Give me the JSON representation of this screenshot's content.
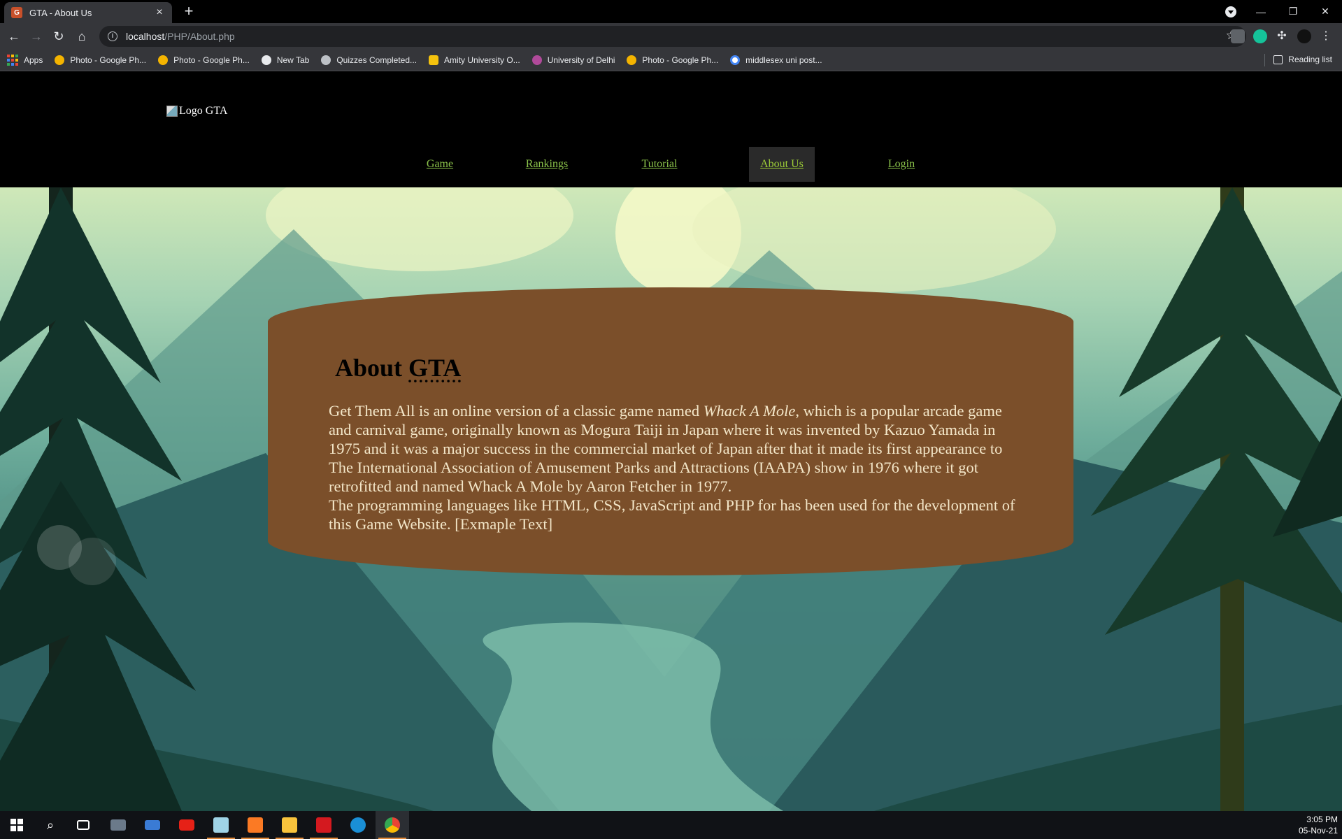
{
  "browser": {
    "tab_title": "GTA - About Us",
    "url_host": "localhost",
    "url_path": "/PHP/About.php",
    "bookmarks": [
      {
        "label": "Apps",
        "color": "#e8eaed"
      },
      {
        "label": "Photo - Google Ph...",
        "color": "#f4b400"
      },
      {
        "label": "Photo - Google Ph...",
        "color": "#f4b400"
      },
      {
        "label": "New Tab",
        "color": "#e8eaed"
      },
      {
        "label": "Quizzes Completed...",
        "color": "#e8eaed"
      },
      {
        "label": "Amity University O...",
        "color": "#f4c20d"
      },
      {
        "label": "University of Delhi",
        "color": "#b04a9a"
      },
      {
        "label": "Photo - Google Ph...",
        "color": "#f4b400"
      },
      {
        "label": "middlesex uni post...",
        "color": "#4285f4"
      }
    ],
    "reading_list": "Reading list"
  },
  "site": {
    "logo_alt": "Logo GTA",
    "nav": [
      {
        "label": "Game"
      },
      {
        "label": "Rankings"
      },
      {
        "label": "Tutorial"
      },
      {
        "label": "About Us",
        "active": true
      },
      {
        "label": "Login"
      }
    ],
    "about": {
      "title_prefix": "About",
      "title_abbr": "GTA",
      "para1_before": "Get Them All is an online version of a classic game named",
      "para1_italic": "Whack A Mole",
      "para1_after": ", which is a popular arcade game and carnival game, originally known as Mogura Taiji in Japan where it was invented by Kazuo Yamada in 1975 and it was a major success in the commercial market of Japan after that it made its first appearance to The International Association of Amusement Parks and Attractions (IAAPA) show in 1976 where it got retrofitted and named Whack A Mole by Aaron Fetcher in 1977.",
      "para2": "The programming languages like HTML, CSS, JavaScript and PHP for has been used for the development of this Game Website. [Exmaple Text]"
    },
    "colors": {
      "nav_link": "#8bc34a",
      "card_bg": "#7b4f2a",
      "card_text": "#f3e6c8"
    }
  },
  "taskbar": {
    "time": "3:05 PM",
    "date": "05-Nov-21",
    "apps": [
      "windows-start",
      "search",
      "task-view",
      "camera",
      "app-blue",
      "youtube",
      "notepad",
      "xampp",
      "file-explorer",
      "acrobat",
      "edge",
      "chrome"
    ]
  }
}
